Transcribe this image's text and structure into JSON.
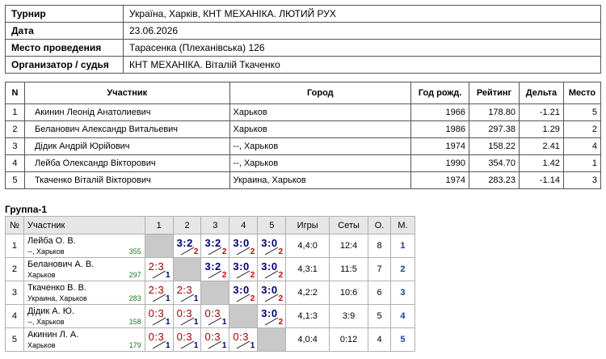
{
  "info": [
    {
      "key": "Турнир",
      "value": "Україна, Харків, КНТ МЕХАНІКА. ЛЮТИЙ РУХ"
    },
    {
      "key": "Дата",
      "value": "23.06.2026"
    },
    {
      "key": "Место проведения",
      "value": "Тарасенка (Плеханівська) 126"
    },
    {
      "key": "Организатор / судья",
      "value": "КНТ МЕХАНІКА. Віталій Ткаченко"
    }
  ],
  "participants": {
    "headers": {
      "n": "N",
      "name": "Участник",
      "city": "Город",
      "year": "Год рожд.",
      "rating": "Рейтинг",
      "delta": "Дельта",
      "place": "Место"
    },
    "rows": [
      {
        "n": "1",
        "name": "Акинин Леонід Анатолиевич",
        "city": "Харьков",
        "year": "1966",
        "rating": "178.80",
        "delta": "-1.21",
        "place": "5"
      },
      {
        "n": "2",
        "name": "Беланович Александр Витальевич",
        "city": "Харьков",
        "year": "1986",
        "rating": "297.38",
        "delta": "1.29",
        "place": "2"
      },
      {
        "n": "3",
        "name": "Дідик Андрій Юрійович",
        "city": "--, Харьков",
        "year": "1974",
        "rating": "158.22",
        "delta": "2.41",
        "place": "4"
      },
      {
        "n": "4",
        "name": "Лейба Олександр Вікторович",
        "city": "--, Харьков",
        "year": "1990",
        "rating": "354.70",
        "delta": "1.42",
        "place": "1"
      },
      {
        "n": "5",
        "name": "Ткаченко Віталій Вікторович",
        "city": "Украина, Харьков",
        "year": "1974",
        "rating": "283.23",
        "delta": "-1.14",
        "place": "3"
      }
    ]
  },
  "group": {
    "title": "Группа-1",
    "headers": {
      "n": "№",
      "player": "Участник",
      "cols": [
        "1",
        "2",
        "3",
        "4",
        "5"
      ],
      "games": "Игры",
      "sets": "Сеты",
      "points": "О.",
      "place": "М."
    },
    "rows": [
      {
        "n": "1",
        "name": "Лейба О. В.",
        "city": "--, Харьков",
        "rating": "355",
        "cells": [
          null,
          {
            "score": "3:2",
            "pts": "2",
            "res": "win"
          },
          {
            "score": "3:2",
            "pts": "2",
            "res": "win"
          },
          {
            "score": "3:0",
            "pts": "2",
            "res": "win"
          },
          {
            "score": "3:0",
            "pts": "2",
            "res": "win"
          }
        ],
        "games": "4,4:0",
        "sets": "12:4",
        "points": "8",
        "place": "1"
      },
      {
        "n": "2",
        "name": "Беланович А. В.",
        "city": "Харьков",
        "rating": "297",
        "cells": [
          {
            "score": "2:3",
            "pts": "1",
            "res": "loss"
          },
          null,
          {
            "score": "3:2",
            "pts": "2",
            "res": "win"
          },
          {
            "score": "3:0",
            "pts": "2",
            "res": "win"
          },
          {
            "score": "3:0",
            "pts": "2",
            "res": "win"
          }
        ],
        "games": "4,3:1",
        "sets": "11:5",
        "points": "7",
        "place": "2"
      },
      {
        "n": "3",
        "name": "Ткаченко В. В.",
        "city": "Украина, Харьков",
        "rating": "283",
        "cells": [
          {
            "score": "2:3",
            "pts": "1",
            "res": "loss"
          },
          {
            "score": "2:3",
            "pts": "1",
            "res": "loss"
          },
          null,
          {
            "score": "3:0",
            "pts": "2",
            "res": "win"
          },
          {
            "score": "3:0",
            "pts": "2",
            "res": "win"
          }
        ],
        "games": "4,2:2",
        "sets": "10:6",
        "points": "6",
        "place": "3"
      },
      {
        "n": "4",
        "name": "Дідик А. Ю.",
        "city": "--, Харьков",
        "rating": "158",
        "cells": [
          {
            "score": "0:3",
            "pts": "1",
            "res": "loss"
          },
          {
            "score": "0:3",
            "pts": "1",
            "res": "loss"
          },
          {
            "score": "0:3",
            "pts": "1",
            "res": "loss"
          },
          null,
          {
            "score": "3:0",
            "pts": "2",
            "res": "win"
          }
        ],
        "games": "4,1:3",
        "sets": "3:9",
        "points": "5",
        "place": "4"
      },
      {
        "n": "5",
        "name": "Акинин Л. А.",
        "city": "Харьков",
        "rating": "179",
        "cells": [
          {
            "score": "0:3",
            "pts": "1",
            "res": "loss"
          },
          {
            "score": "0:3",
            "pts": "1",
            "res": "loss"
          },
          {
            "score": "0:3",
            "pts": "1",
            "res": "loss"
          },
          {
            "score": "0:3",
            "pts": "1",
            "res": "loss"
          },
          null
        ],
        "games": "4,0:4",
        "sets": "0:12",
        "points": "4",
        "place": "5"
      }
    ]
  }
}
